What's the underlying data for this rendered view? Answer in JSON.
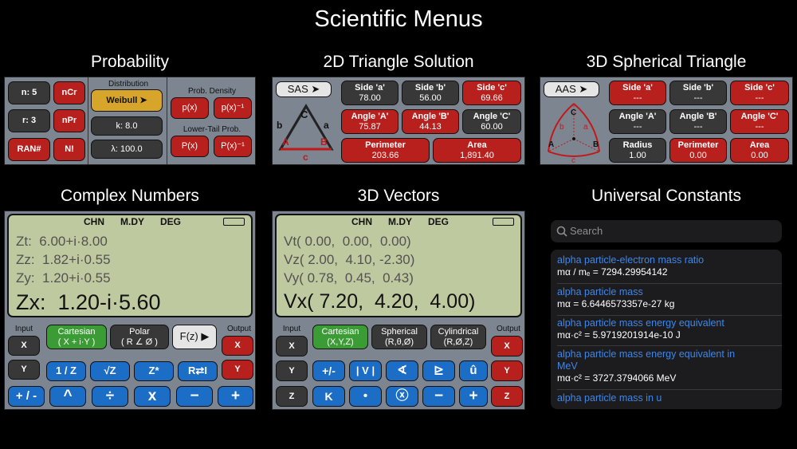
{
  "title": "Scientific Menus",
  "probability": {
    "title": "Probability",
    "left_buttons": [
      "n: 5",
      "nCr",
      "r: 3",
      "nPr",
      "RAN#",
      "N!"
    ],
    "distribution_label": "Distribution",
    "distribution_value": "Weibull ➤",
    "k": "k: 8.0",
    "lambda": "λ: 100.0",
    "density_label": "Prob. Density",
    "lower_tail_label": "Lower-Tail Prob.",
    "px": "p(x)",
    "px_inv": "p(x)⁻¹",
    "cap_px": "P(x)",
    "cap_px_inv": "P(x)⁻¹"
  },
  "triangle2d": {
    "title": "2D Triangle Solution",
    "mode": "SAS ➤",
    "cells": [
      {
        "label": "Side 'a'",
        "value": "78.00",
        "red": false
      },
      {
        "label": "Side 'b'",
        "value": "56.00",
        "red": false
      },
      {
        "label": "Side 'c'",
        "value": "69.66",
        "red": true
      },
      {
        "label": "Angle 'A'",
        "value": "75.87",
        "red": true
      },
      {
        "label": "Angle 'B'",
        "value": "44.13",
        "red": true
      },
      {
        "label": "Angle 'C'",
        "value": "60.00",
        "red": false
      }
    ],
    "perimeter": {
      "label": "Perimeter",
      "value": "203.66"
    },
    "area": {
      "label": "Area",
      "value": "1,891.40"
    },
    "diagram": {
      "A": "A",
      "B": "B",
      "C": "C",
      "a": "a",
      "b": "b",
      "c": "c"
    }
  },
  "triangle3d": {
    "title": "3D Spherical Triangle",
    "mode": "AAS ➤",
    "cells": [
      {
        "label": "Side 'a'",
        "value": "---",
        "red": true
      },
      {
        "label": "Side 'b'",
        "value": "---",
        "red": false
      },
      {
        "label": "Side 'c'",
        "value": "---",
        "red": true
      },
      {
        "label": "Angle 'A'",
        "value": "---",
        "red": false
      },
      {
        "label": "Angle 'B'",
        "value": "---",
        "red": false
      },
      {
        "label": "Angle 'C'",
        "value": "---",
        "red": true
      },
      {
        "label": "Radius",
        "value": "1.00",
        "red": false
      },
      {
        "label": "Perimeter",
        "value": "0.00",
        "red": true
      },
      {
        "label": "Area",
        "value": "0.00",
        "red": true
      }
    ],
    "diagram": {
      "A": "A",
      "B": "B",
      "C": "C",
      "a": "a",
      "b": "b",
      "c": "c"
    }
  },
  "complex": {
    "title": "Complex Numbers",
    "status": [
      "CHN",
      "M.DY",
      "DEG"
    ],
    "lines": [
      "Zt:  6.00+i·8.00",
      "Zz:  1.82+i·0.55",
      "Zy:  1.20+i·0.55"
    ],
    "x_line": "Zx:  1.20-i·5.60",
    "input_label": "Input",
    "output_label": "Output",
    "cartesian": {
      "top": "Cartesian",
      "bottom": "( X + i·Y )"
    },
    "polar": {
      "top": "Polar",
      "bottom": "( R ∠ Ø )"
    },
    "fz": "F(z) ▶",
    "in_x": "X",
    "in_y": "Y",
    "out_x": "X",
    "out_y": "Y",
    "row2": [
      "1 / Z",
      "√Z",
      "Z*",
      "R⇄I"
    ],
    "row3": [
      "+ / -",
      "^",
      "÷",
      "x",
      "−",
      "+"
    ]
  },
  "vectors": {
    "title": "3D Vectors",
    "status": [
      "CHN",
      "M.DY",
      "DEG"
    ],
    "lines": [
      "Vt( 0.00,  0.00,  0.00)",
      "Vz( 2.00,  4.10, -2.30)",
      "Vy( 0.78,  0.45,  0.43)"
    ],
    "x_line": "Vx( 7.20,  4.20,  4.00)",
    "input_label": "Input",
    "output_label": "Output",
    "cartesian": {
      "top": "Cartesian",
      "bottom": "(X,Y,Z)"
    },
    "spherical": {
      "top": "Spherical",
      "bottom": "(R,θ,Ø)"
    },
    "cylindrical": {
      "top": "Cylindrical",
      "bottom": "(R,Ø,Z)"
    },
    "in": [
      "X",
      "Y",
      "Z"
    ],
    "out": [
      "X",
      "Y",
      "Z"
    ],
    "row2": [
      "+/-",
      "| V |",
      "∢",
      "⊵",
      "û"
    ],
    "row3": [
      "K",
      "•",
      "ⓧ",
      "−",
      "+"
    ]
  },
  "constants": {
    "title": "Universal Constants",
    "search_placeholder": "Search",
    "items": [
      {
        "name": "alpha particle-electron mass ratio",
        "value": "mα / mₑ = 7294.29954142"
      },
      {
        "name": "alpha particle mass",
        "value": "mα = 6.6446573357e-27  kg"
      },
      {
        "name": "alpha particle mass energy equivalent",
        "value": "mα·c² = 5.9719201914e-10  J"
      },
      {
        "name": "alpha particle mass energy equivalent in MeV",
        "value": "mα·c² = 3727.3794066  MeV"
      },
      {
        "name": "alpha particle mass in u",
        "value": ""
      }
    ]
  }
}
